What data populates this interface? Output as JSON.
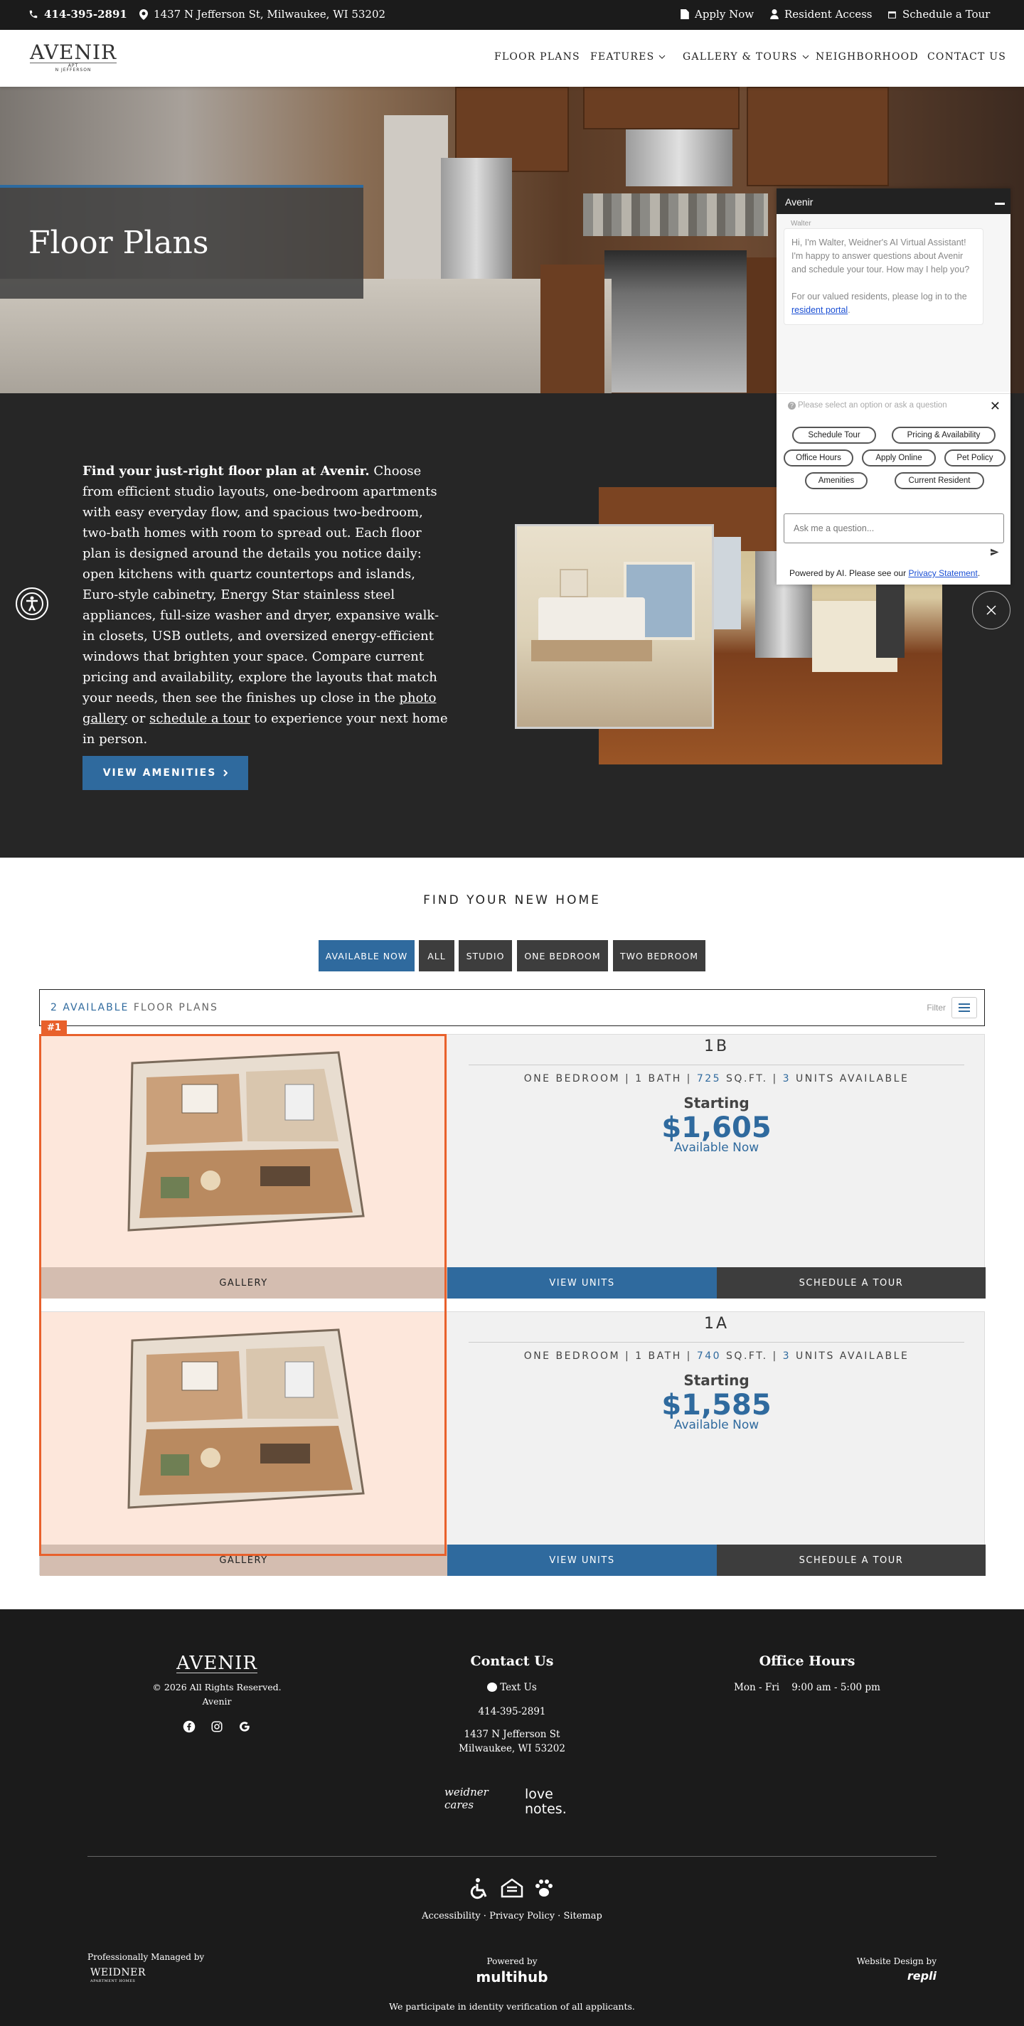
{
  "topbar": {
    "phone": "414-395-2891",
    "address": "1437 N Jefferson St, Milwaukee, WI 53202",
    "apply": "Apply Now",
    "resident": "Resident Access",
    "schedule": "Schedule a Tour"
  },
  "header": {
    "logo_big": "AVENIR",
    "logo_apt": "APT",
    "logo_street": "N JEFFERSON",
    "nav": {
      "floor_plans": "FLOOR PLANS",
      "features": "FEATURES",
      "gallery": "GALLERY & TOURS",
      "neighborhood": "NEIGHBORHOOD",
      "contact": "CONTACT US"
    }
  },
  "hero": {
    "title": "Floor Plans"
  },
  "intro": {
    "bold": "Find your just-right floor plan at Avenir.",
    "text1": " Choose from efficient studio layouts, one-bedroom apartments with easy everyday flow, and spacious two-bedroom, two-bath homes with room to spread out. Each floor plan is designed around the details you notice daily: open kitchens with quartz countertops and islands, Euro-style cabinetry, Energy Star stainless steel appliances, full-size washer and dryer, expansive walk-in closets, USB outlets, and oversized energy-efficient windows that brighten your space. Compare current pricing and availability, explore the layouts that match your needs, then see the finishes up close in the ",
    "link1": "photo gallery",
    "text2": " or ",
    "link2": "schedule a tour",
    "text3": " to experience your next home in person.",
    "button": "VIEW AMENITIES"
  },
  "chat": {
    "title": "Avenir",
    "sender": "Walter",
    "message1": "Hi, I'm Walter, Weidner's AI Virtual Assistant! I'm happy to answer questions about Avenir and schedule your tour. How may I help you?",
    "message2": "For our valued residents, please log in to the ",
    "portal": "resident portal",
    "period": ".",
    "prompt": "Please select an option or ask a question",
    "options": [
      "Schedule Tour",
      "Pricing & Availability",
      "Office Hours",
      "Apply Online",
      "Pet Policy",
      "Amenities",
      "Current Resident"
    ],
    "input_placeholder": "Ask me a question...",
    "footer": "Powered by AI. Please see our ",
    "privacy": "Privacy Statement",
    "footer_end": "."
  },
  "find": {
    "title": "FIND YOUR NEW HOME",
    "filters": [
      "AVAILABLE NOW",
      "ALL",
      "STUDIO",
      "ONE BEDROOM",
      "TWO BEDROOM"
    ],
    "active_filter": "AVAILABLE NOW",
    "count": "2 AVAILABLE",
    "count_rest": " FLOOR PLANS",
    "filter_label": "Filter"
  },
  "plans": [
    {
      "name": "1B",
      "type": "ONE BEDROOM",
      "bath": "1 BATH",
      "sqft": "725",
      "sqft_unit": "SQ.FT.",
      "units": "3",
      "units_label": "UNITS AVAILABLE",
      "starting": "Starting",
      "price": "$1,605",
      "available": "Available Now",
      "gallery": "GALLERY",
      "view_units": "VIEW UNITS",
      "schedule": "SCHEDULE A TOUR"
    },
    {
      "name": "1A",
      "type": "ONE BEDROOM",
      "bath": "1 BATH",
      "sqft": "740",
      "sqft_unit": "SQ.FT.",
      "units": "3",
      "units_label": "UNITS AVAILABLE",
      "starting": "Starting",
      "price": "$1,585",
      "available": "Available Now",
      "gallery": "GALLERY",
      "view_units": "VIEW UNITS",
      "schedule": "SCHEDULE A TOUR"
    }
  ],
  "highlight_tag": "#1",
  "footer": {
    "logo_big": "AVENIR",
    "copyright": "© 2026 All Rights Reserved. Avenir",
    "contact_title": "Contact Us",
    "text_us": "Text Us",
    "phone": "414-395-2891",
    "street": "1437 N Jefferson St",
    "city": "Milwaukee, WI 53202",
    "hours_title": "Office Hours",
    "hours_days": "Mon - Fri",
    "hours_time": "9:00 am - 5:00 pm",
    "weidner_cares": "weidner cares",
    "love_notes": "love notes.",
    "accessibility": "Accessibility",
    "privacy": "Privacy Policy",
    "sitemap": "Sitemap",
    "managed_by": "Professionally Managed by",
    "weidner": "WEIDNER",
    "weidner_sub": "APARTMENT HOMES",
    "powered_by": "Powered by",
    "multihub": "multihub",
    "design_by": "Website Design by",
    "repli": "repli",
    "verification": "We participate in identity verification of all applicants."
  },
  "colors": {
    "accent": "#2f6a9e",
    "highlight": "#e8612c",
    "dark": "#262626",
    "footer": "#1b1b1b"
  },
  "icons": [
    "phone-icon",
    "location-icon",
    "document-icon",
    "person-icon",
    "calendar-icon",
    "chevron-down-icon",
    "accessibility-icon",
    "close-icon",
    "send-icon",
    "menu-icon",
    "facebook-icon",
    "instagram-icon",
    "google-icon",
    "wheelchair-icon",
    "equal-housing-icon",
    "pet-paw-icon",
    "chat-icon",
    "help-icon"
  ]
}
